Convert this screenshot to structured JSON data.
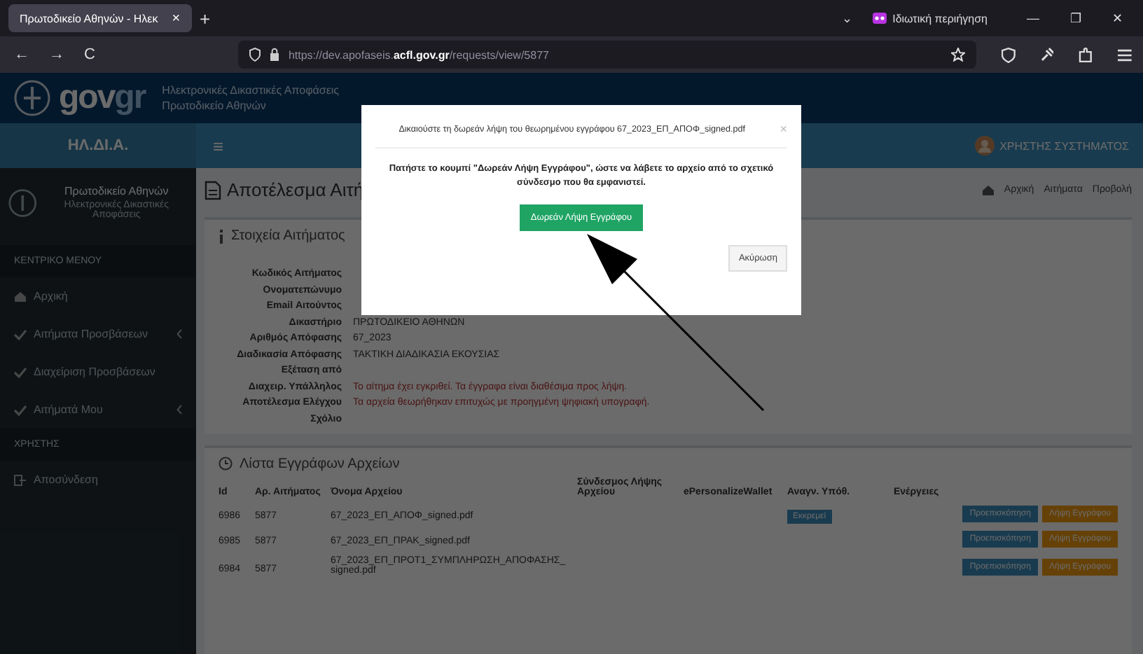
{
  "browser": {
    "tabs": [
      {
        "label": "Πρωτοδικείο Αθηνών - Ηλεκ",
        "close": "×",
        "selected": true
      }
    ],
    "new_tab": "+",
    "list_tabs": "⌄",
    "private_label": "Ιδιωτική περιήγηση",
    "window_controls": [
      "—",
      "❐",
      "✕"
    ],
    "nav_buttons": [
      "←",
      "→",
      "C"
    ],
    "url": {
      "prefix": "https://dev.apofaseis.",
      "domain": "acfl.gov.gr",
      "path": "/requests/view/5877"
    }
  },
  "header": {
    "logo_a": "gov",
    "logo_b": "gr",
    "title": "Ηλεκτρονικές Δικαστικές Αποφάσεις",
    "subtitle": "Πρωτοδικείο Αθηνών"
  },
  "navbar": {
    "brand": "ΗΛ.ΔΙ.Α.",
    "menu": "≡",
    "user": "ΧΡΗΣΤΗΣ ΣΥΣΤΗΜΑΤΟΣ"
  },
  "sidebar": {
    "court": "Πρωτοδικείο Αθηνών",
    "court_subtitle": "Ηλεκτρονικές Δικαστικές Αποφάσεις",
    "items": [
      {
        "kind": "heading",
        "label": "ΚΕΝΤΡΙΚΟ ΜΕΝΟΥ"
      },
      {
        "kind": "home",
        "label": "Αρχική",
        "submenu": false
      },
      {
        "kind": "check",
        "label": "Αιτήματα Προσβάσεων",
        "submenu": true
      },
      {
        "kind": "check",
        "label": "Διαχείριση Προσβάσεων",
        "submenu": false
      },
      {
        "kind": "check",
        "label": "Αιτήματά Μου",
        "submenu": true
      },
      {
        "kind": "heading",
        "label": "ΧΡΗΣΤΗΣ"
      },
      {
        "kind": "logout",
        "label": "Αποσύνδεση",
        "submenu": false
      }
    ]
  },
  "page": {
    "title": "Αποτέλεσμα Αιτή",
    "breadcrumb": [
      "Αρχική",
      "Αιτήματα",
      "Προβολή"
    ],
    "section_title": "Στοιχεία Αιτήματος",
    "fields": [
      {
        "label": "Κωδικός Αιτήματος",
        "kind": "plain"
      },
      {
        "label": "Ονοματεπώνυμο",
        "kind": "plain"
      },
      {
        "label": "Email Αιτούντος",
        "kind": "plain"
      },
      {
        "label": "Δικαστήριο",
        "value": "ΠΡΩΤΟΔΙΚΕΙΟ ΑΘΗΝΩΝ",
        "kind": "plain"
      },
      {
        "label": "Αριθμός Απόφασης",
        "value": "67_2023",
        "kind": "plain"
      },
      {
        "label": "Διαδικασία Απόφασης",
        "value": "ΤΑΚΤΙΚΗ ΔΙΑΔΙΚΑΣΙΑ ΕΚΟΥΣΙΑΣ",
        "kind": "plain"
      },
      {
        "label": "Εξέταση από",
        "kind": "plain"
      },
      {
        "label": "Διαχειρ. Υπάλληλος",
        "value": "Το αίτημα έχει εγκριθεί. Τα έγγραφα είναι διαθέσιμα προς λήψη.",
        "kind": "alert"
      },
      {
        "label": "Αποτέλεσμα Ελέγχου",
        "value": "Τα αρχεία θεωρήθηκαν επιτυχώς με προηγμένη ψηφιακή υπογραφή.",
        "kind": "alert"
      },
      {
        "label": "Σχόλιο",
        "kind": "plain"
      }
    ]
  },
  "files": {
    "title": "Λίστα Εγγράφων Αρχείων",
    "columns": [
      "Id",
      "Αρ. Αιτήματος",
      "Όνομα Αρχείου",
      "Σύνδεσμος Λήψης Αρχείου",
      "ePersonalizeWallet",
      "Αναγν. Υπόθ.",
      "Ενέργειες"
    ],
    "rows": [
      {
        "cells": [
          "6986",
          "5877",
          "67_2023_ΕΠ_ΑΠΟΦ_signed.pdf",
          "",
          "",
          ""
        ],
        "badge": "Εκκρεμεί",
        "actions": [
          "Προεπισκόπηση",
          "Λήψη Εγγράφου"
        ]
      },
      {
        "cells": [
          "6985",
          "5877",
          "67_2023_ΕΠ_ΠΡΑΚ_signed.pdf",
          "",
          "",
          ""
        ],
        "badge": "",
        "actions": [
          "Προεπισκόπηση",
          "Λήψη Εγγράφου"
        ]
      },
      {
        "cells": [
          "6984",
          "5877",
          "67_2023_ΕΠ_ΠΡΟΤ1_ΣΥΜΠΛΗΡΩΣΗ_ΑΠΟΦΑΣΗΣ_signed.pdf",
          "",
          "",
          ""
        ],
        "badge": "",
        "actions": [
          "Προεπισκόπηση",
          "Λήψη Εγγράφου"
        ]
      }
    ]
  },
  "modal": {
    "title": "Δικαιούστε τη δωρεάν λήψη του θεωρημένου εγγράφου 67_2023_ΕΠ_ΑΠΟΦ_signed.pdf",
    "close": "×",
    "message": "Πατήστε το κουμπί \"Δωρεάν Λήψη Εγγράφου\", ώστε να λάβετε το αρχείο από το σχετικό σύνδεσμο που θα εμφανιστεί.",
    "primary": "Δωρεάν Λήψη Εγγράφου",
    "cancel": "Ακύρωση"
  }
}
